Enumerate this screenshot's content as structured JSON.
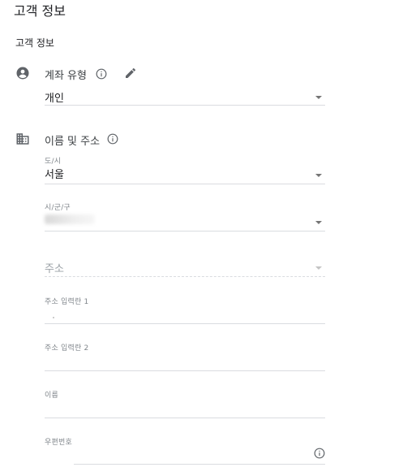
{
  "page": {
    "title": "고객 정보"
  },
  "section": {
    "title": "고객 정보"
  },
  "account_type": {
    "label": "계좌 유형",
    "value": "개인"
  },
  "name_address": {
    "label": "이름 및 주소",
    "fields": {
      "state": {
        "label": "도/시",
        "value": "서울"
      },
      "city": {
        "label": "시/군/구"
      },
      "address": {
        "placeholder": "주소"
      },
      "address_line1": {
        "label": "주소 입력란 1"
      },
      "address_line2": {
        "label": "주소 입력란 2"
      },
      "name": {
        "label": "이름"
      },
      "postal_code": {
        "label": "우편번호"
      }
    }
  },
  "icons": {
    "account": "account-circle-icon",
    "info": "info-icon",
    "edit": "pencil-edit-icon",
    "business": "building-icon",
    "dropdown": "caret-down-icon"
  },
  "colors": {
    "text": "#202124",
    "muted": "#80868b",
    "line": "#dadce0",
    "icon": "#5f6368"
  }
}
